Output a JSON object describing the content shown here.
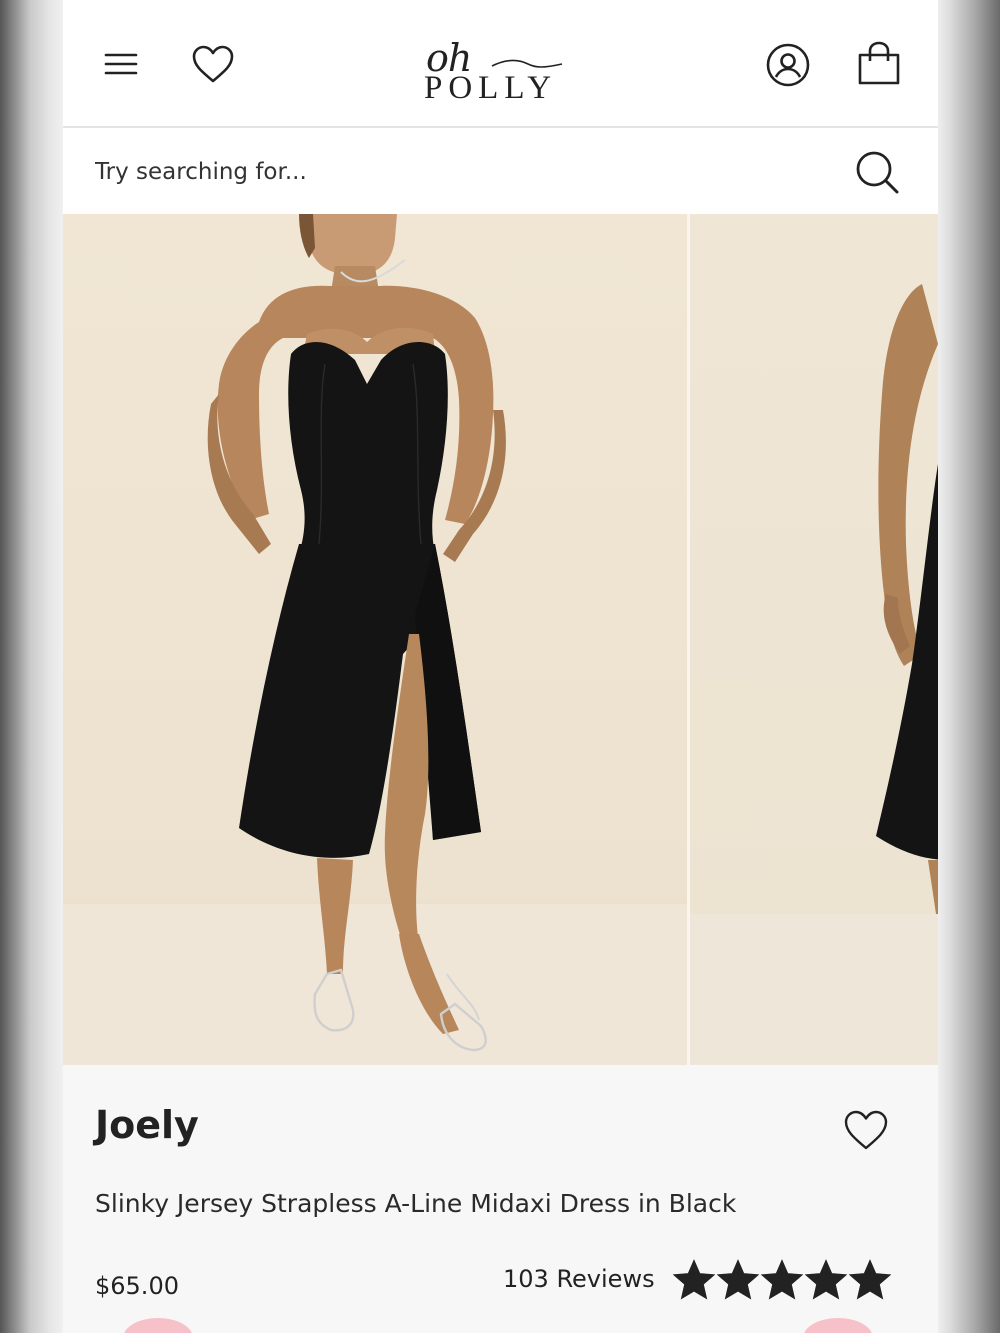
{
  "header": {
    "brand_script": "oh",
    "brand_word": "POLLY",
    "icons": {
      "menu": "hamburger-menu-icon",
      "wishlist": "heart-outline-icon",
      "account": "user-circle-icon",
      "bag": "shopping-bag-icon"
    }
  },
  "search": {
    "placeholder": "Try searching for...",
    "icon": "search-icon"
  },
  "gallery": {
    "images": [
      "Model in black strapless A-line midaxi dress with thigh slit, front view",
      "Model in black dress, side view"
    ]
  },
  "product": {
    "name": "Joely",
    "description": "Slinky Jersey Strapless A-Line Midaxi Dress in Black",
    "price": "$65.00",
    "reviews_label": "103 Reviews",
    "rating": 5,
    "rating_max": 5
  },
  "colors": {
    "text": "#222222",
    "background": "#ffffff",
    "info_background": "#f7f7f7",
    "dress": "#141414",
    "studio_backdrop": "#efe4d1"
  }
}
